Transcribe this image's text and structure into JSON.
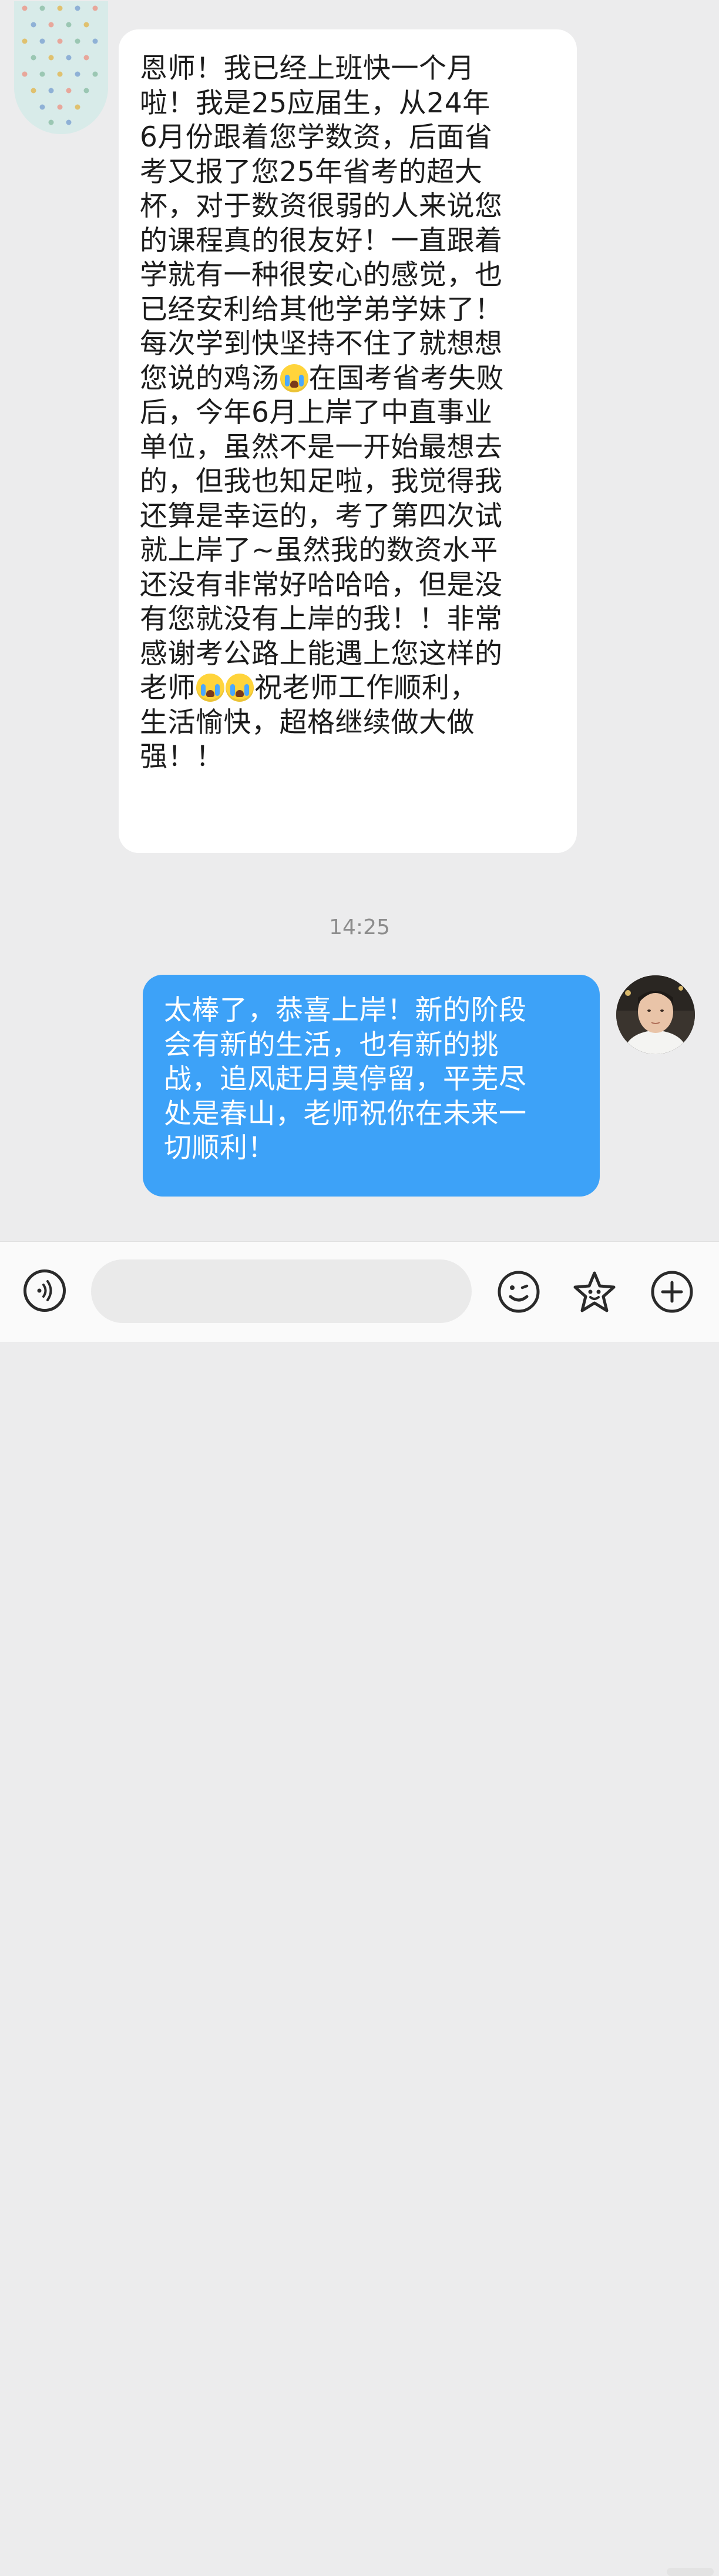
{
  "conversation": {
    "incoming_message": {
      "line1": "恩师！我已经上班快一个月\n啦！我是25应届生，从24年\n6月份跟着您学数资，后面省\n考又报了您25年省考的超大\n杯，对于数资很弱的人来说您\n的课程真的很友好！一直跟着\n学就有一种很安心的感觉，也\n已经安利给其他学弟学妹了！\n每次学到快坚持不住了就想想\n您说的鸡汤",
      "line2": "在国考省考失败\n后，今年6月上岸了中直事业\n单位，虽然不是一开始最想去\n的，但我也知足啦，我觉得我\n还算是幸运的，考了第四次试\n就上岸了~虽然我的数资水平\n还没有非常好哈哈哈，但是没\n有您就没有上岸的我！！非常\n感谢考公路上能遇上您这样的\n老师",
      "line3": "祝老师工作顺利，\n生活愉快，超格继续做大做\n强！！",
      "emoji": "loudly-crying-face"
    },
    "timestamp": "14:25",
    "outgoing_message": {
      "text": "太棒了，恭喜上岸！新的阶段\n会有新的生活，也有新的挑\n战，追风赶月莫停留，平芜尽\n处是春山，老师祝你在未来一\n切顺利！"
    }
  },
  "input_bar": {
    "placeholder": "",
    "icons": [
      "voice-icon",
      "emoji-smile-icon",
      "sticker-icon",
      "plus-icon"
    ]
  },
  "colors": {
    "background": "#ececed",
    "incoming_bubble": "#ffffff",
    "outgoing_bubble": "#3da2f8",
    "timestamp_text": "#8c8c8c"
  }
}
